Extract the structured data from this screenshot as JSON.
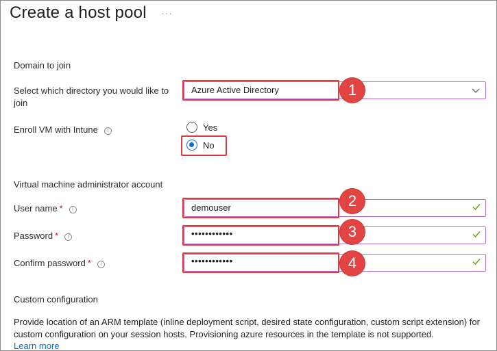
{
  "header": {
    "title": "Create a host pool",
    "more": "···"
  },
  "domain": {
    "section": "Domain to join",
    "directory_label": "Select which directory you would like to join",
    "directory_value": "Azure Active Directory",
    "intune_label": "Enroll VM with Intune",
    "options": [
      {
        "label": "Yes",
        "selected": false
      },
      {
        "label": "No",
        "selected": true
      }
    ]
  },
  "admin": {
    "section": "Virtual machine administrator account",
    "username_label": "User name",
    "username_value": "demouser",
    "password_label": "Password",
    "password_value": "••••••••••••",
    "confirm_label": "Confirm password",
    "confirm_value": "••••••••••••",
    "required_marker": "*"
  },
  "custom": {
    "section": "Custom configuration",
    "description": "Provide location of an ARM template (inline deployment script, desired state configuration, custom script extension) for custom configuration on your session hosts. Provisioning azure resources in the template is not supported.",
    "link": "Learn more"
  },
  "callouts": [
    "1",
    "2",
    "3",
    "4"
  ],
  "colors": {
    "accent": "#0f6cbd",
    "callout": "#e24444",
    "field_border": "#b36cc8",
    "valid_check": "#57a300",
    "required": "#c50f1f"
  },
  "icons": {
    "info": "info-icon",
    "chevron": "chevron-down-icon",
    "check": "checkmark-icon"
  }
}
